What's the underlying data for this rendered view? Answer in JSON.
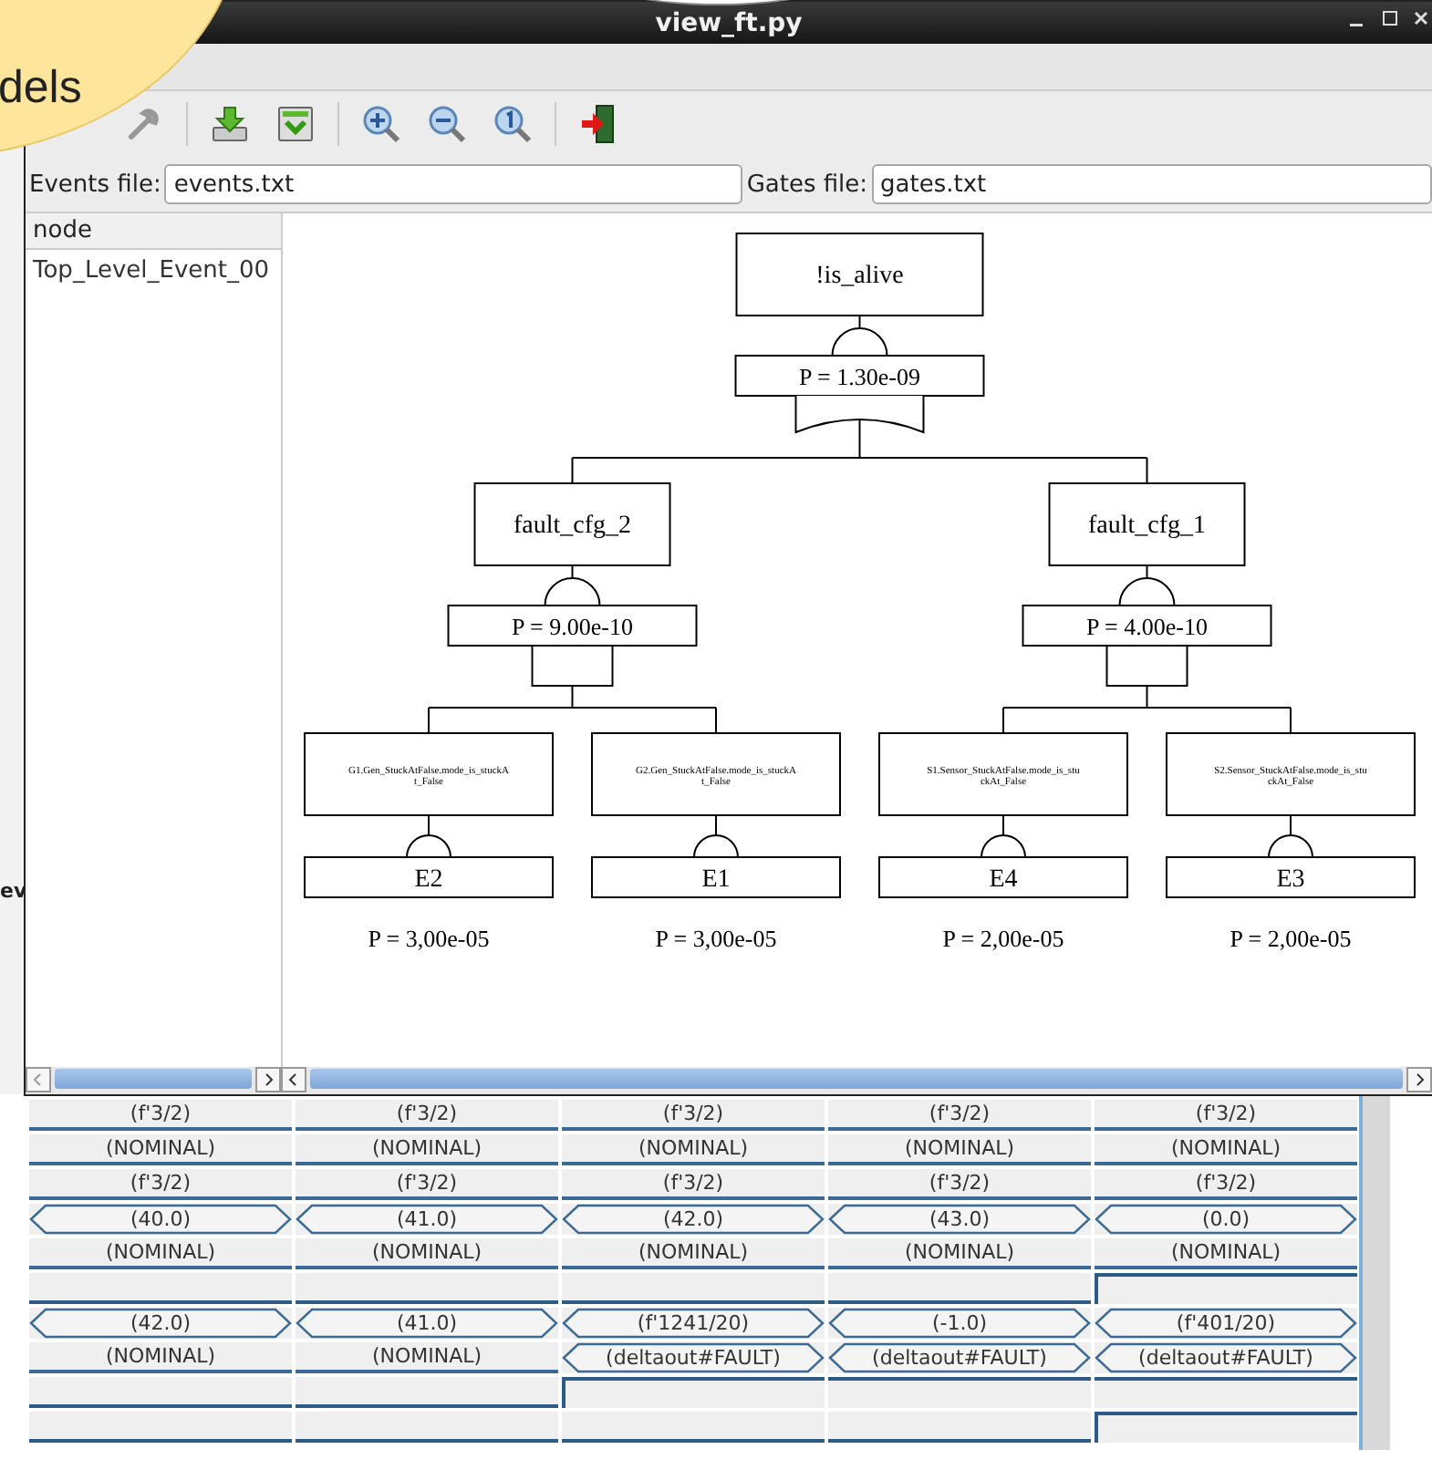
{
  "callout": {
    "text": "dels"
  },
  "background_window": {
    "text": "ev"
  },
  "window": {
    "title": "view_ft.py"
  },
  "toolbar": [
    {
      "kind": "tool",
      "disabled": true
    },
    {
      "kind": "sep"
    },
    {
      "kind": "load"
    },
    {
      "kind": "load-check"
    },
    {
      "kind": "sep"
    },
    {
      "kind": "zoom-in"
    },
    {
      "kind": "zoom-out"
    },
    {
      "kind": "zoom-reset"
    },
    {
      "kind": "sep"
    },
    {
      "kind": "exit"
    }
  ],
  "files": [
    {
      "label": "Events file:",
      "value": "events.txt"
    },
    {
      "label": "Gates file:",
      "value": "gates.txt"
    }
  ],
  "tree": {
    "header": "node",
    "items": [
      {
        "label": "Top_Level_Event_00",
        "selected": false
      }
    ]
  },
  "fault_tree": {
    "label": "!is_alive",
    "probability": "P = 1.30e-09",
    "kind": "or",
    "children": [
      {
        "label": "fault_cfg_2",
        "kind": "and",
        "probability": "P = 9.00e-10",
        "children": [
          {
            "label_lines": [
              "G1.Gen_StuckAtFalse.mode_is_stuckA",
              "t_False"
            ],
            "event": "E2",
            "probability": "P = 3,00e-05"
          },
          {
            "label_lines": [
              "G2.Gen_StuckAtFalse.mode_is_stuckA",
              "t_False"
            ],
            "event": "E1",
            "probability": "P = 3,00e-05"
          }
        ]
      },
      {
        "label": "fault_cfg_1",
        "kind": "and",
        "probability": "P = 4.00e-10",
        "children": [
          {
            "label_lines": [
              "S1.Sensor_StuckAtFalse.mode_is_stu",
              "ckAt_False"
            ],
            "event": "E4",
            "probability": "P = 2,00e-05"
          },
          {
            "label_lines": [
              "S2.Sensor_StuckAtFalse.mode_is_stu",
              "ckAt_False"
            ],
            "event": "E3",
            "probability": "P = 2,00e-05"
          }
        ]
      }
    ]
  },
  "trace": {
    "rows": [
      {
        "kind": "value",
        "cells": [
          {
            "text": "(f'3/2)",
            "change": false
          },
          {
            "text": "(f'3/2)",
            "change": false
          },
          {
            "text": "(f'3/2)",
            "change": false
          },
          {
            "text": "(f'3/2)",
            "change": false
          },
          {
            "text": "(f'3/2)",
            "change": false
          }
        ]
      },
      {
        "kind": "value",
        "cells": [
          {
            "text": "(NOMINAL)",
            "change": false
          },
          {
            "text": "(NOMINAL)",
            "change": false
          },
          {
            "text": "(NOMINAL)",
            "change": false
          },
          {
            "text": "(NOMINAL)",
            "change": false
          },
          {
            "text": "(NOMINAL)",
            "change": false
          }
        ]
      },
      {
        "kind": "value",
        "cells": [
          {
            "text": "(f'3/2)",
            "change": false
          },
          {
            "text": "(f'3/2)",
            "change": false
          },
          {
            "text": "(f'3/2)",
            "change": false
          },
          {
            "text": "(f'3/2)",
            "change": false
          },
          {
            "text": "(f'3/2)",
            "change": false
          }
        ]
      },
      {
        "kind": "value",
        "cells": [
          {
            "text": "(40.0)",
            "change": true
          },
          {
            "text": "(41.0)",
            "change": true
          },
          {
            "text": "(42.0)",
            "change": true
          },
          {
            "text": "(43.0)",
            "change": true
          },
          {
            "text": "(0.0)",
            "change": true
          }
        ]
      },
      {
        "kind": "value",
        "cells": [
          {
            "text": "(NOMINAL)",
            "change": false
          },
          {
            "text": "(NOMINAL)",
            "change": false
          },
          {
            "text": "(NOMINAL)",
            "change": false
          },
          {
            "text": "(NOMINAL)",
            "change": false
          },
          {
            "text": "(NOMINAL)",
            "change": false
          }
        ]
      },
      {
        "kind": "bit",
        "cells": [
          {
            "high": false
          },
          {
            "high": false
          },
          {
            "high": false
          },
          {
            "high": false
          },
          {
            "high": true
          }
        ]
      },
      {
        "kind": "value",
        "cells": [
          {
            "text": "(42.0)",
            "change": true
          },
          {
            "text": "(41.0)",
            "change": true
          },
          {
            "text": "(f'1241/20)",
            "change": true
          },
          {
            "text": "(-1.0)",
            "change": true
          },
          {
            "text": "(f'401/20)",
            "change": true
          }
        ]
      },
      {
        "kind": "value",
        "cells": [
          {
            "text": "(NOMINAL)",
            "change": false
          },
          {
            "text": "(NOMINAL)",
            "change": false
          },
          {
            "text": "(deltaout#FAULT)",
            "change": true
          },
          {
            "text": "(deltaout#FAULT)",
            "change": true
          },
          {
            "text": "(deltaout#FAULT)",
            "change": true
          }
        ]
      },
      {
        "kind": "bit",
        "cells": [
          {
            "high": false
          },
          {
            "high": false
          },
          {
            "high": true
          },
          {
            "high": true
          },
          {
            "high": true
          }
        ]
      },
      {
        "kind": "bit",
        "cells": [
          {
            "high": false
          },
          {
            "high": false
          },
          {
            "high": false
          },
          {
            "high": false
          },
          {
            "high": true
          }
        ]
      }
    ]
  }
}
